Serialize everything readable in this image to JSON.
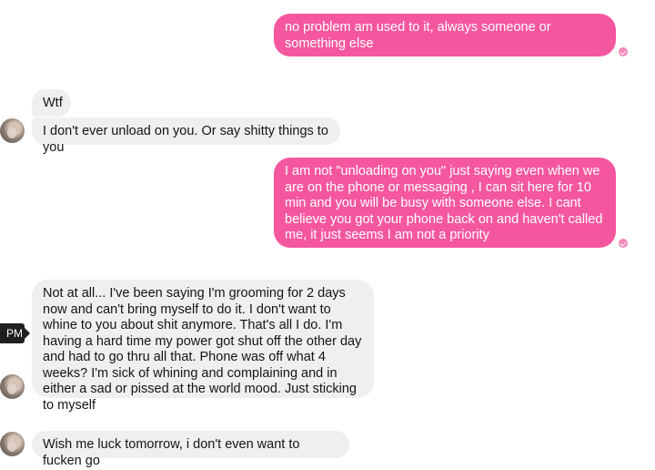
{
  "messages": [
    {
      "direction": "outgoing",
      "text": "no problem am used to it, always someone or something else"
    },
    {
      "direction": "incoming",
      "text": "Wtf"
    },
    {
      "direction": "incoming",
      "text": "I don't ever unload on you. Or say shitty things to you"
    },
    {
      "direction": "outgoing",
      "text": "I am not \"unloading on you\" just saying even when we are on the phone or messaging , I can sit here for 10 min and you will be busy with someone else.  I cant believe you got your phone back on and haven't called me,  it just seems I am not a priority"
    },
    {
      "direction": "incoming",
      "text": "Not at all... I've been saying I'm grooming for 2 days now and can't bring myself to do it. I don't want to whine to you about shit anymore. That's all I do. I'm having a hard time my power got shut off the other day and had to go thru all that. Phone was off what 4 weeks? I'm sick of whining and complaining and in either a sad or pissed at the world mood. Just sticking to myself"
    },
    {
      "direction": "incoming",
      "text": "Wish me luck tomorrow, i don't even want to fucken go"
    }
  ],
  "timestamp_tooltip": "PM",
  "colors": {
    "outgoing_bubble": "#f5579e",
    "incoming_bubble": "#f0eff0",
    "read_receipt": "#f187b6"
  }
}
